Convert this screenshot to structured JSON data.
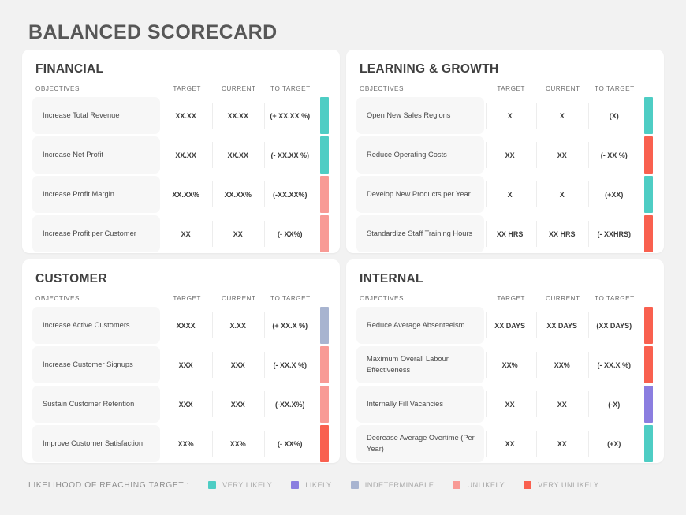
{
  "title": "BALANCED SCORECARD",
  "columns": {
    "objectives": "OBJECTIVES",
    "target": "TARGET",
    "current": "CURRENT",
    "to_target": "TO TARGET"
  },
  "colors": {
    "very_likely": "#4ecdc4",
    "likely": "#8b7ee0",
    "indeterminable": "#a8b4d0",
    "unlikely": "#f89a95",
    "very_unlikely": "#f9604f",
    "title": "#575757",
    "background": "#f2f2f2",
    "card": "#ffffff",
    "row": "#f7f7f7"
  },
  "cards": [
    {
      "title": "FINANCIAL",
      "rows": [
        {
          "objective": "Increase Total Revenue",
          "target": "XX.XX",
          "current": "XX.XX",
          "to_target": "(+ XX.XX %)",
          "status": "very_likely"
        },
        {
          "objective": "Increase Net Profit",
          "target": "XX.XX",
          "current": "XX.XX",
          "to_target": "(- XX.XX %)",
          "status": "very_likely"
        },
        {
          "objective": "Increase Profit Margin",
          "target": "XX.XX%",
          "current": "XX.XX%",
          "to_target": "(-XX.XX%)",
          "status": "unlikely"
        },
        {
          "objective": "Increase Profit per Customer",
          "target": "XX",
          "current": "XX",
          "to_target": "(- XX%)",
          "status": "unlikely"
        }
      ]
    },
    {
      "title": "LEARNING & GROWTH",
      "rows": [
        {
          "objective": "Open New Sales Regions",
          "target": "X",
          "current": "X",
          "to_target": "(X)",
          "status": "very_likely"
        },
        {
          "objective": "Reduce Operating Costs",
          "target": "XX",
          "current": "XX",
          "to_target": "(- XX %)",
          "status": "very_unlikely"
        },
        {
          "objective": "Develop New Products per Year",
          "target": "X",
          "current": "X",
          "to_target": "(+XX)",
          "status": "very_likely"
        },
        {
          "objective": "Standardize Staff Training Hours",
          "target": "XX HRS",
          "current": "XX HRS",
          "to_target": "(- XXHRS)",
          "status": "very_unlikely"
        }
      ]
    },
    {
      "title": "CUSTOMER",
      "rows": [
        {
          "objective": "Increase Active Customers",
          "target": "XXXX",
          "current": "X.XX",
          "to_target": "(+ XX.X %)",
          "status": "indeterminable"
        },
        {
          "objective": "Increase Customer Signups",
          "target": "XXX",
          "current": "XXX",
          "to_target": "(- XX.X %)",
          "status": "unlikely"
        },
        {
          "objective": "Sustain Customer Retention",
          "target": "XXX",
          "current": "XXX",
          "to_target": "(-XX.X%)",
          "status": "unlikely"
        },
        {
          "objective": "Improve Customer Satisfaction",
          "target": "XX%",
          "current": "XX%",
          "to_target": "(- XX%)",
          "status": "very_unlikely"
        }
      ]
    },
    {
      "title": "INTERNAL",
      "rows": [
        {
          "objective": "Reduce Average Absenteeism",
          "target": "XX DAYS",
          "current": "XX DAYS",
          "to_target": "(XX DAYS)",
          "status": "very_unlikely"
        },
        {
          "objective": "Maximum Overall Labour Effectiveness",
          "target": "XX%",
          "current": "XX%",
          "to_target": "(- XX.X %)",
          "status": "very_unlikely"
        },
        {
          "objective": "Internally Fill Vacancies",
          "target": "XX",
          "current": "XX",
          "to_target": "(-X)",
          "status": "likely"
        },
        {
          "objective": "Decrease Average Overtime (Per Year)",
          "target": "XX",
          "current": "XX",
          "to_target": "(+X)",
          "status": "very_likely"
        }
      ]
    }
  ],
  "legend": {
    "label": "LIKELIHOOD OF REACHING TARGET :",
    "items": [
      {
        "text": "VERY LIKELY",
        "color": "#4ecdc4"
      },
      {
        "text": "LIKELY",
        "color": "#8b7ee0"
      },
      {
        "text": "INDETERMINABLE",
        "color": "#a8b4d0"
      },
      {
        "text": "UNLIKELY",
        "color": "#f89a95"
      },
      {
        "text": "VERY UNLIKELY",
        "color": "#f9604f"
      }
    ]
  }
}
